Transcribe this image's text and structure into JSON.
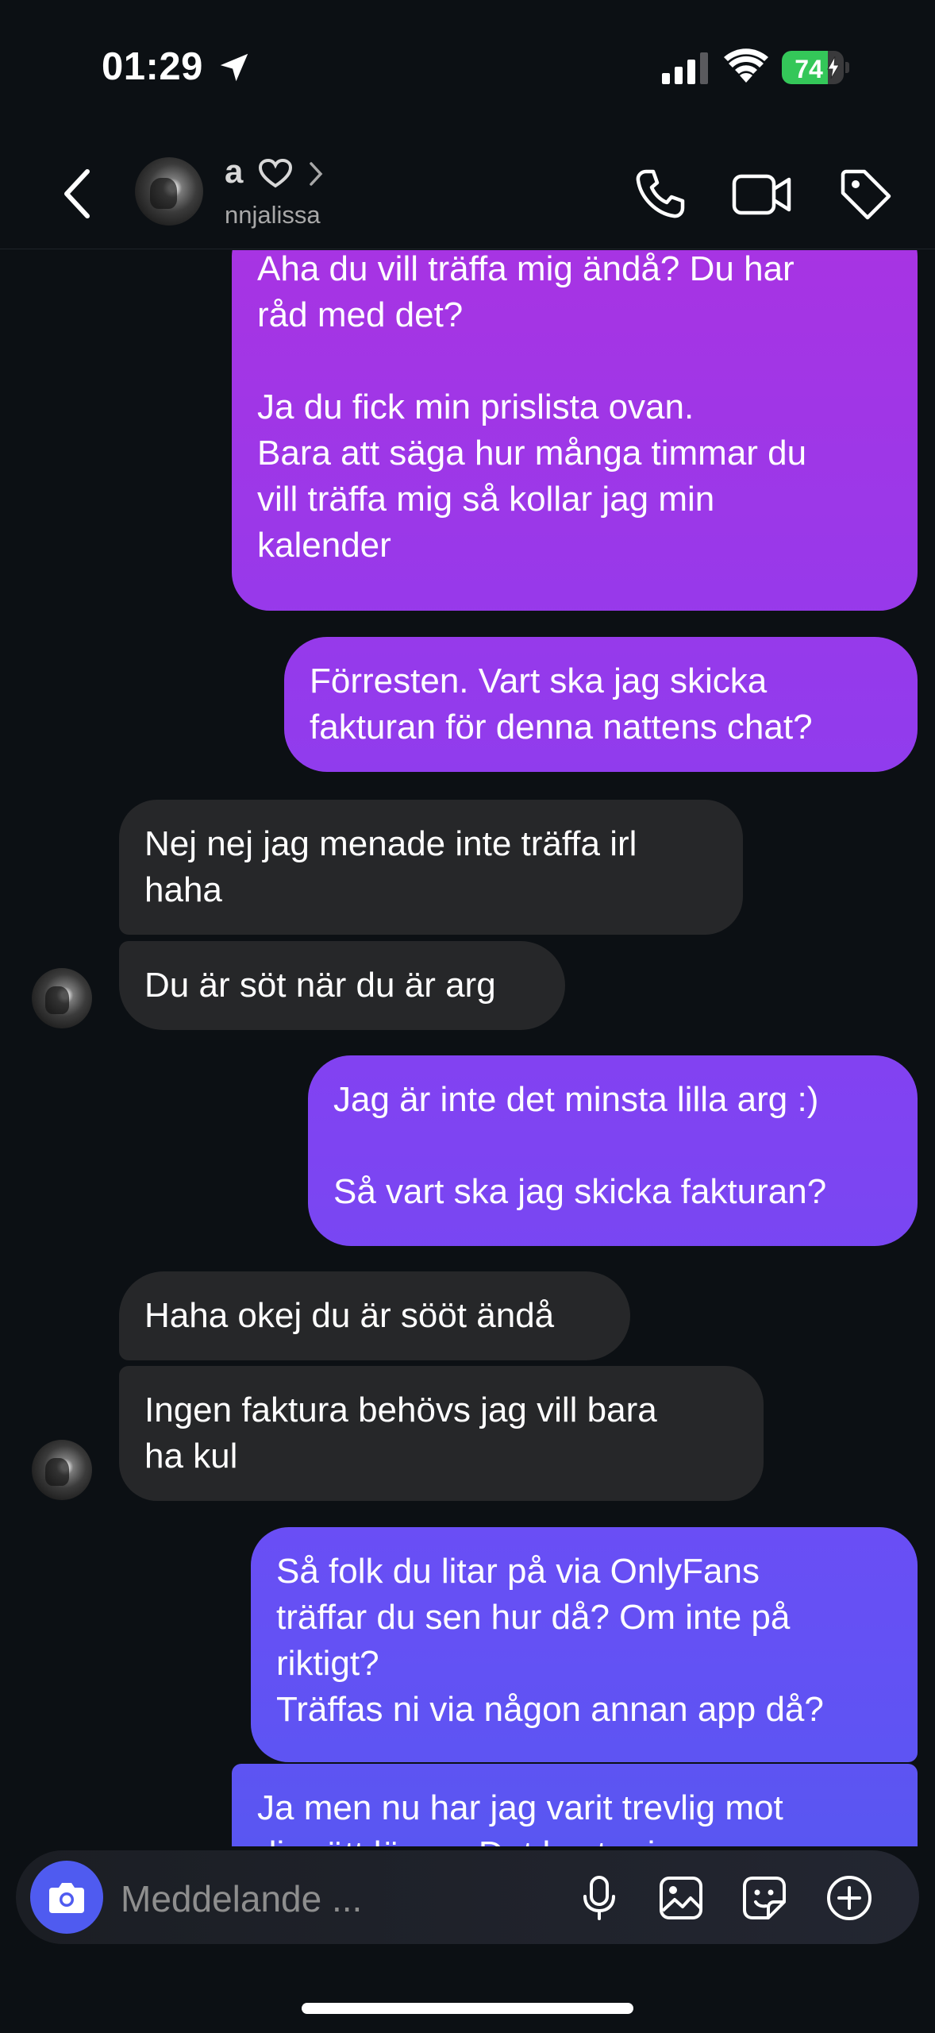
{
  "status_bar": {
    "time": "01:29",
    "battery_percent": "74",
    "battery_level": 0.74
  },
  "header": {
    "name": "a",
    "username": "nnjalissa"
  },
  "messages": [
    {
      "side": "out",
      "lines": [
        "Aha du vill träffa mig ändå? Du har",
        "råd med det?",
        "",
        "Ja du fick min prislista ovan.",
        "Bara att säga hur många timmar du",
        "vill träffa mig så kollar jag min",
        "kalender"
      ]
    },
    {
      "side": "out",
      "lines": [
        "Förresten. Vart ska jag skicka",
        "fakturan för denna nattens chat?"
      ]
    },
    {
      "side": "in",
      "lines": [
        "Nej nej jag menade inte träffa irl",
        "haha"
      ]
    },
    {
      "side": "in",
      "lines": [
        "Du är söt när du är arg"
      ]
    },
    {
      "side": "out",
      "lines": [
        "Jag är inte det minsta lilla arg :)",
        "",
        "Så vart ska jag skicka fakturan?"
      ]
    },
    {
      "side": "in",
      "lines": [
        "Haha okej du är sööt ändå"
      ]
    },
    {
      "side": "in",
      "lines": [
        "Ingen faktura behövs jag vill bara",
        "ha kul"
      ]
    },
    {
      "side": "out",
      "lines": [
        "Så folk du litar på via OnlyFans",
        "träffar du sen hur då? Om inte på",
        "riktigt?",
        "Träffas ni via någon annan app då?"
      ]
    },
    {
      "side": "out",
      "lines": [
        "Ja men nu har jag varit trevlig mot",
        "dig rätt länge. Det kostar ju pengar"
      ]
    }
  ],
  "composer": {
    "placeholder": "Meddelande ..."
  },
  "colors": {
    "background": "#0c1014",
    "incoming_bubble": "#262729",
    "outgoing_top": "#b230de",
    "outgoing_bottom": "#4f5bf0",
    "accent": "#4f5bf0",
    "battery": "#34c759"
  },
  "icons": [
    "back-icon",
    "heart-icon",
    "chevron-right-icon",
    "phone-icon",
    "video-camera-icon",
    "tag-icon",
    "camera-icon",
    "microphone-icon",
    "image-icon",
    "sticker-icon",
    "plus-circle-icon",
    "location-arrow-icon",
    "signal-icon",
    "wifi-icon",
    "battery-icon"
  ]
}
